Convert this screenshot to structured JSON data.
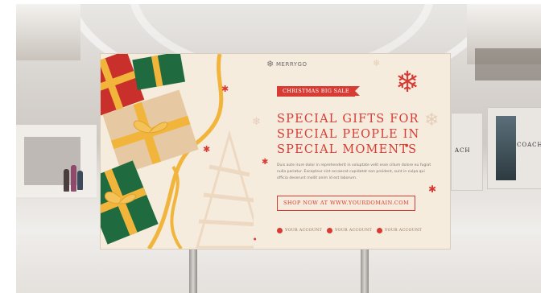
{
  "poster": {
    "brand": "MERRYGO",
    "tag": "CHRISTMAS BIG SALE",
    "headline": [
      "SPECIAL GIFTS FOR",
      "SPECIAL PEOPLE IN",
      "SPECIAL MOMENTS"
    ],
    "body": "Duis aute irure dolor in reprehenderit in voluptate velit esse cillum dolore eu fugiat nulla pariatur. Excepteur sint occaecat cupidatat non proident, sunt in culpa qui officia deserunt mollit anim id est laborum.",
    "cta": "SHOP NOW AT WWW.YOURDOMAIN.COM",
    "social": [
      {
        "icon": "facebook-icon",
        "label": "YOUR ACCOUNT"
      },
      {
        "icon": "instagram-icon",
        "label": "YOUR ACCOUNT"
      },
      {
        "icon": "twitter-icon",
        "label": "YOUR ACCOUNT"
      }
    ]
  },
  "background": {
    "store_sign_1": "COACH",
    "store_sign_2": "ACH"
  },
  "colors": {
    "accent": "#d83a34",
    "poster_bg": "#f6ecdd",
    "gift_red": "#c9302c",
    "gift_green": "#1f6b3f",
    "gift_kraft": "#e6c9a3",
    "ribbon": "#f1b53c"
  }
}
